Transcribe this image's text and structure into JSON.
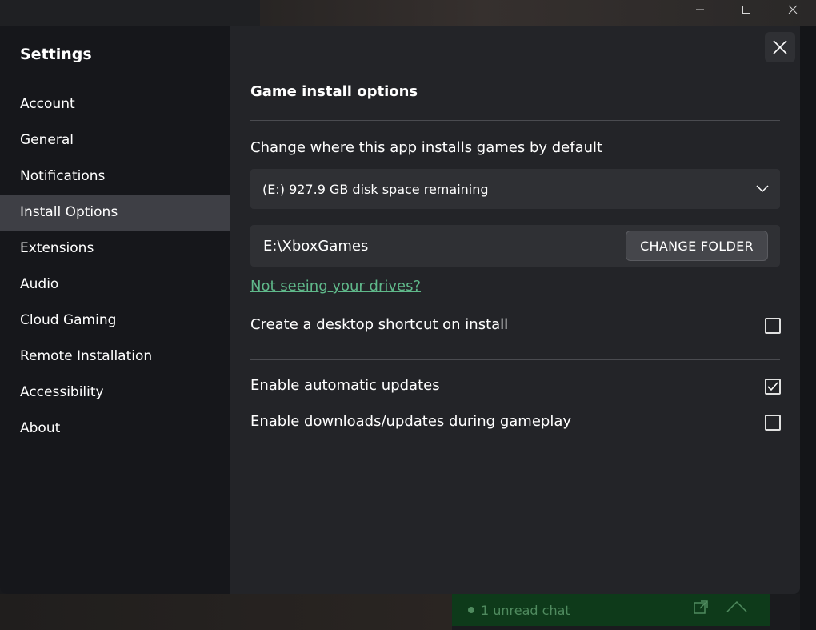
{
  "background": {
    "chat_label": "1 unread chat",
    "chat_color": "#0e3a1a"
  },
  "window_controls": {
    "minimize_icon": "minimize-icon",
    "maximize_icon": "maximize-icon",
    "close_icon": "close-icon"
  },
  "settings": {
    "title": "Settings",
    "nav_items": [
      {
        "label": "Account"
      },
      {
        "label": "General"
      },
      {
        "label": "Notifications"
      },
      {
        "label": "Install Options",
        "active": true
      },
      {
        "label": "Extensions"
      },
      {
        "label": "Audio"
      },
      {
        "label": "Cloud Gaming"
      },
      {
        "label": "Remote Installation"
      },
      {
        "label": "Accessibility"
      },
      {
        "label": "About"
      }
    ]
  },
  "install": {
    "section_title": "Game install options",
    "change_location_label": "Change where this app installs games by default",
    "drive_selected": "(E:) 927.9 GB disk space remaining",
    "folder_path": "E:\\XboxGames",
    "change_folder_label": "CHANGE FOLDER",
    "drives_link": "Not seeing your drives?",
    "desktop_shortcut_label": "Create a desktop shortcut on install",
    "desktop_shortcut_checked": false,
    "auto_updates_label": "Enable automatic updates",
    "auto_updates_checked": true,
    "gameplay_downloads_label": "Enable downloads/updates during gameplay",
    "gameplay_downloads_checked": false
  },
  "colors": {
    "accent_link": "#5fb88a",
    "active_nav": "#3e3f45"
  }
}
